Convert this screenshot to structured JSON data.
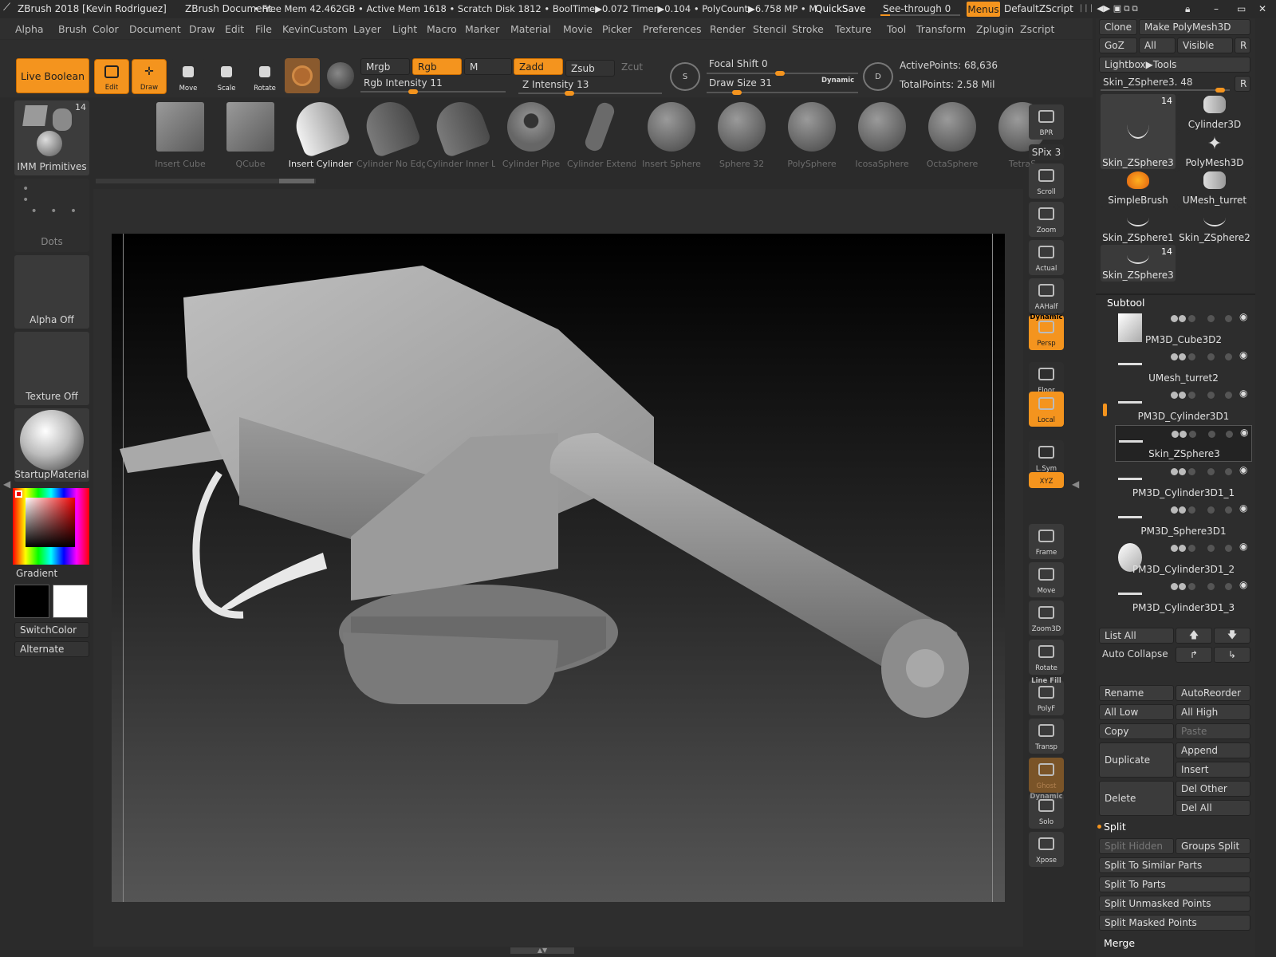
{
  "title_bar": {
    "app": "ZBrush 2018 [Kevin Rodriguez]",
    "doc": "ZBrush Document",
    "stats": "• Free Mem 42.462GB • Active Mem 1618 • Scratch Disk 1812 •  BoolTime▶0.072 Timer▶0.104 • PolyCount▶6.758 MP  • M",
    "quicksave": "QuickSave",
    "see_through": "See-through  0",
    "menus": "Menus",
    "script": "DefaultZScript"
  },
  "menu_items": [
    "Alpha",
    "Brush",
    "Color",
    "Document",
    "Draw",
    "Edit",
    "File",
    "KevinCustom",
    "Layer",
    "Light",
    "Macro",
    "Marker",
    "Material",
    "Movie",
    "Picker",
    "Preferences",
    "Render",
    "Stencil",
    "Stroke",
    "Texture",
    "Tool",
    "Transform",
    "Zplugin",
    "Zscript"
  ],
  "toolbar": {
    "live_boolean": "Live Boolean",
    "edit": "Edit",
    "draw": "Draw",
    "move": "Move",
    "scale": "Scale",
    "rotate": "Rotate",
    "mrgb": "Mrgb",
    "rgb": "Rgb",
    "m": "M",
    "zadd": "Zadd",
    "zsub": "Zsub",
    "zcut": "Zcut",
    "rgb_intensity": "Rgb Intensity 11",
    "z_intensity": "Z Intensity 13",
    "focal_shift": "Focal Shift 0",
    "draw_size": "Draw Size 31",
    "dynamic": "Dynamic",
    "active_points": "ActivePoints: 68,636",
    "total_points": "TotalPoints: 2.58 Mil"
  },
  "left_shelf": {
    "imm": "IMM Primitives",
    "imm_count": "14",
    "dots": "Dots",
    "alpha": "Alpha Off",
    "texture": "Texture Off",
    "material": "StartupMaterial",
    "gradient": "Gradient",
    "switch_color": "SwitchColor",
    "alternate": "Alternate"
  },
  "primitives": [
    "Insert Cube",
    "QCube",
    "Insert Cylinder",
    "Cylinder No Edg",
    "Cylinder Inner L",
    "Cylinder Pipe",
    "Cylinder Extend",
    "Insert Sphere",
    "Sphere 32",
    "PolySphere",
    "IcosaSphere",
    "OctaSphere",
    "TetraS"
  ],
  "right_shelf": [
    "BPR",
    "SPix 3",
    "Scroll",
    "Zoom",
    "Actual",
    "AAHalf",
    "Persp",
    "Floor",
    "Local",
    "L.Sym",
    "XYZ",
    "Frame",
    "Move",
    "Zoom3D",
    "Rotate",
    "PolyF",
    "Transp",
    "Ghost",
    "Solo",
    "Xpose"
  ],
  "right_shelf_labels": {
    "dynamic": "Dynamic",
    "line_fill": "Line Fill"
  },
  "tool_panel": {
    "clone": "Clone",
    "make_poly": "Make PolyMesh3D",
    "goz": "GoZ",
    "all": "All",
    "visible": "Visible",
    "r": "R",
    "lightbox": "Lightbox▶Tools",
    "skin_slider": "Skin_ZSphere3. 48",
    "tools": [
      {
        "name": "Skin_ZSphere3",
        "count": "14"
      },
      {
        "name": "Cylinder3D",
        "count": ""
      },
      {
        "name": "PolyMesh3D",
        "count": ""
      },
      {
        "name": "SimpleBrush",
        "count": ""
      },
      {
        "name": "UMesh_turret",
        "count": ""
      },
      {
        "name": "Skin_ZSphere1",
        "count": ""
      },
      {
        "name": "Skin_ZSphere2",
        "count": ""
      },
      {
        "name": "Skin_ZSphere3",
        "count": "14"
      }
    ]
  },
  "subtool": {
    "header": "Subtool",
    "items": [
      "PM3D_Cube3D2",
      "UMesh_turret2",
      "PM3D_Cylinder3D1",
      "Skin_ZSphere3",
      "PM3D_Cylinder3D1_1",
      "PM3D_Sphere3D1",
      "PM3D_Cylinder3D1_2",
      "PM3D_Cylinder3D1_3"
    ],
    "list_all": "List All",
    "auto_collapse": "Auto Collapse",
    "rename": "Rename",
    "autoreorder": "AutoReorder",
    "all_low": "All Low",
    "all_high": "All High",
    "copy": "Copy",
    "paste": "Paste",
    "duplicate": "Duplicate",
    "append": "Append",
    "insert": "Insert",
    "delete": "Delete",
    "del_other": "Del Other",
    "del_all": "Del All",
    "split": "Split",
    "split_hidden": "Split Hidden",
    "groups_split": "Groups Split",
    "split_similar": "Split To Similar Parts",
    "split_parts": "Split To Parts",
    "split_unmasked": "Split Unmasked Points",
    "split_masked": "Split Masked Points",
    "merge": "Merge"
  },
  "colors": {
    "accent": "#f4941e",
    "bg": "#2b2b2b",
    "panel": "#333333"
  }
}
